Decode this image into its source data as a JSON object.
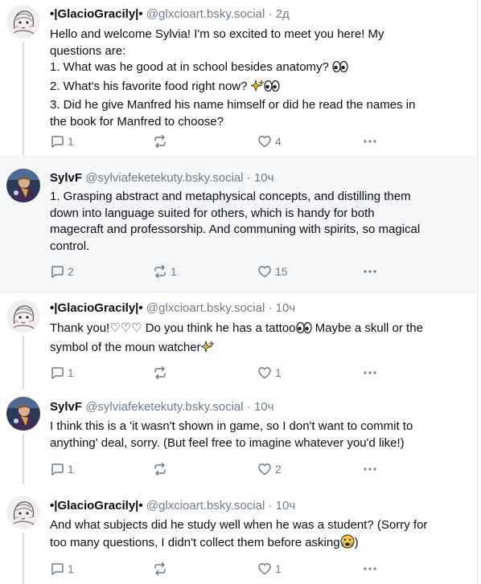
{
  "posts": [
    {
      "author": "•|GlacioGracily|•",
      "handle": "@glxcioart.bsky.social",
      "time": "2д",
      "avatar": "sketch-avatar",
      "lines": [
        "Hello and welcome Sylvia! I'm so excited to meet you here! My",
        "questions are:",
        "1. What was he good at in school besides anatomy?",
        "2. What's his favorite food right now?",
        "3. Did he give Manfred his name himself or did he read the names in",
        "the book for Manfred to choose?"
      ],
      "replies": "1",
      "reposts": "",
      "likes": "4"
    },
    {
      "author": "SylvF",
      "handle": "@sylviafeketekuty.bsky.social",
      "time": "10ч",
      "avatar": "portrait-avatar",
      "lines": [
        "1. Grasping abstract and metaphysical concepts, and distilling them",
        "down into language suited for others, which is handy for both",
        "magecraft and professorship. And communing with spirits, so magical",
        "control."
      ],
      "replies": "2",
      "reposts": "1",
      "likes": "15"
    },
    {
      "author": "•|GlacioGracily|•",
      "handle": "@glxcioart.bsky.social",
      "time": "10ч",
      "avatar": "sketch-avatar",
      "lines": [
        "Thank you!♡♡♡ Do you think he has a tattoo",
        "symbol of the moun watcher"
      ],
      "line1_tail": " Maybe a skull or the",
      "replies": "1",
      "reposts": "",
      "likes": "1"
    },
    {
      "author": "SylvF",
      "handle": "@sylviafeketekuty.bsky.social",
      "time": "10ч",
      "avatar": "portrait-avatar",
      "lines": [
        "I think this is a 'it wasn't shown in game, so I don't want to commit to",
        "anything' deal, sorry. (But feel free to imagine whatever you'd like!)"
      ],
      "replies": "1",
      "reposts": "",
      "likes": "2"
    },
    {
      "author": "•|GlacioGracily|•",
      "handle": "@glxcioart.bsky.social",
      "time": "10ч",
      "avatar": "sketch-avatar",
      "lines": [
        "And what subjects did he study well when he was a student? (Sorry for",
        "too many questions, I didn't collect them before asking",
        ")"
      ],
      "replies": "1",
      "reposts": "",
      "likes": "1"
    }
  ],
  "separator": "·",
  "icons": {
    "reply": "reply-bubble-icon",
    "repost": "repost-arrows-icon",
    "like": "heart-icon",
    "more": "more-dots-icon"
  },
  "colors": {
    "text": "#0b0f14",
    "muted": "#6f7c89",
    "highlight_bg": "#f4f6f8",
    "thread_line": "#d5dbe1"
  }
}
